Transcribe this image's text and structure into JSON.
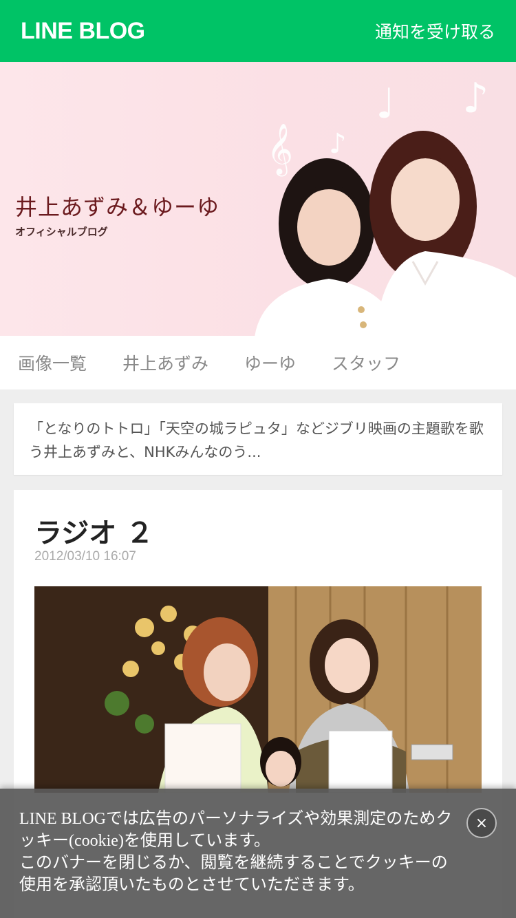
{
  "header": {
    "logo": "LINE BLOG",
    "notify_label": "通知を受け取る"
  },
  "hero": {
    "title": "井上あずみ＆ゆーゆ",
    "subtitle": "オフィシャルブログ"
  },
  "nav": {
    "items": [
      {
        "label": "画像一覧"
      },
      {
        "label": "井上あずみ"
      },
      {
        "label": "ゆーゆ"
      },
      {
        "label": "スタッフ"
      }
    ]
  },
  "description": {
    "text": "「となりのトトロ」「天空の城ラピュタ」などジブリ映画の主題歌を歌う井上あずみと、NHKみんなのう..."
  },
  "post": {
    "title": "ラジオ ２",
    "date": "2012/03/10 16:07"
  },
  "cookie_banner": {
    "line1": "LINE BLOGでは広告のパーソナライズや効果測定のためクッキー(cookie)を使用しています。",
    "line2": "このバナーを閉じるか、閲覧を継続することでクッキーの使用を承認頂いたものとさせていただきます。",
    "close_label": "×"
  },
  "colors": {
    "brand_green": "#00c366",
    "hero_pink": "#fbe0e5",
    "title_maroon": "#6b1a1e"
  }
}
